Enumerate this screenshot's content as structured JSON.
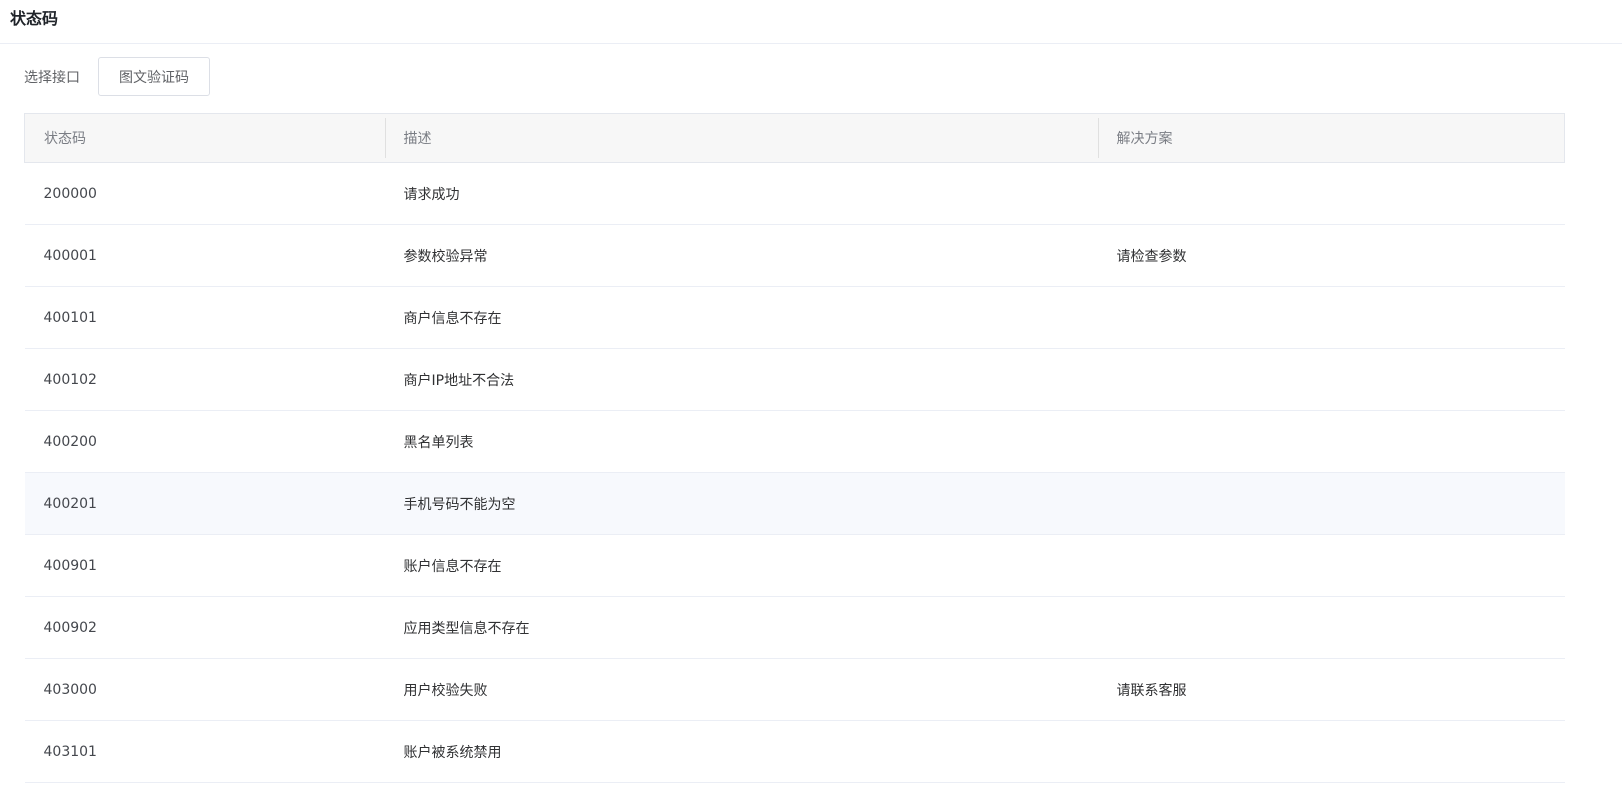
{
  "page": {
    "title": "状态码"
  },
  "selector": {
    "label": "选择接口",
    "selected": "图文验证码"
  },
  "table": {
    "columns": [
      "状态码",
      "描述",
      "解决方案"
    ],
    "rows": [
      {
        "code": "200000",
        "description": "请求成功",
        "solution": ""
      },
      {
        "code": "400001",
        "description": "参数校验异常",
        "solution": "请检查参数"
      },
      {
        "code": "400101",
        "description": "商户信息不存在",
        "solution": ""
      },
      {
        "code": "400102",
        "description": "商户IP地址不合法",
        "solution": ""
      },
      {
        "code": "400200",
        "description": "黑名单列表",
        "solution": ""
      },
      {
        "code": "400201",
        "description": "手机号码不能为空",
        "solution": "",
        "highlighted": true
      },
      {
        "code": "400901",
        "description": "账户信息不存在",
        "solution": ""
      },
      {
        "code": "400902",
        "description": "应用类型信息不存在",
        "solution": ""
      },
      {
        "code": "403000",
        "description": "用户校验失败",
        "solution": "请联系客服"
      },
      {
        "code": "403101",
        "description": "账户被系统禁用",
        "solution": ""
      }
    ]
  },
  "colors": {
    "header_bg": "#f7f7f7",
    "row_highlight": "#f7f9fd",
    "border": "#ebeef5"
  }
}
